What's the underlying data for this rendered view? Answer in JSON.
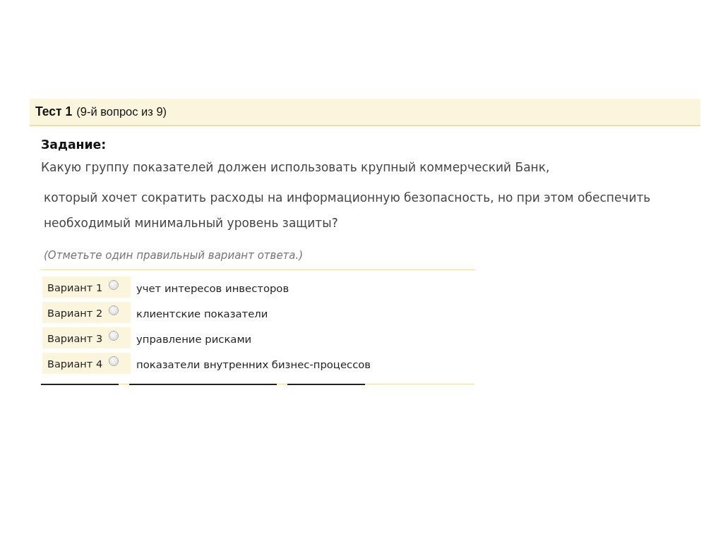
{
  "header": {
    "title": "Тест 1",
    "counter": "(9-й вопрос из 9)"
  },
  "task": {
    "label": "Задание:",
    "question_lines": [
      "Какую группу показателей должен использовать крупный коммерческий Банк,",
      "который хочет сократить расходы на информационную безопасность, но при этом обеспечить",
      "необходимый минимальный уровень защиты?"
    ],
    "instruction": "(Отметьте один правильный вариант ответа.)"
  },
  "options": [
    {
      "label": "Вариант 1",
      "text": "учет интересов инвесторов",
      "selected": false
    },
    {
      "label": "Вариант 2",
      "text": "клиентские показатели",
      "selected": false
    },
    {
      "label": "Вариант 3",
      "text": "управление рисками",
      "selected": false
    },
    {
      "label": "Вариант 4",
      "text": "показатели внутренних бизнес-процессов",
      "selected": false
    }
  ]
}
